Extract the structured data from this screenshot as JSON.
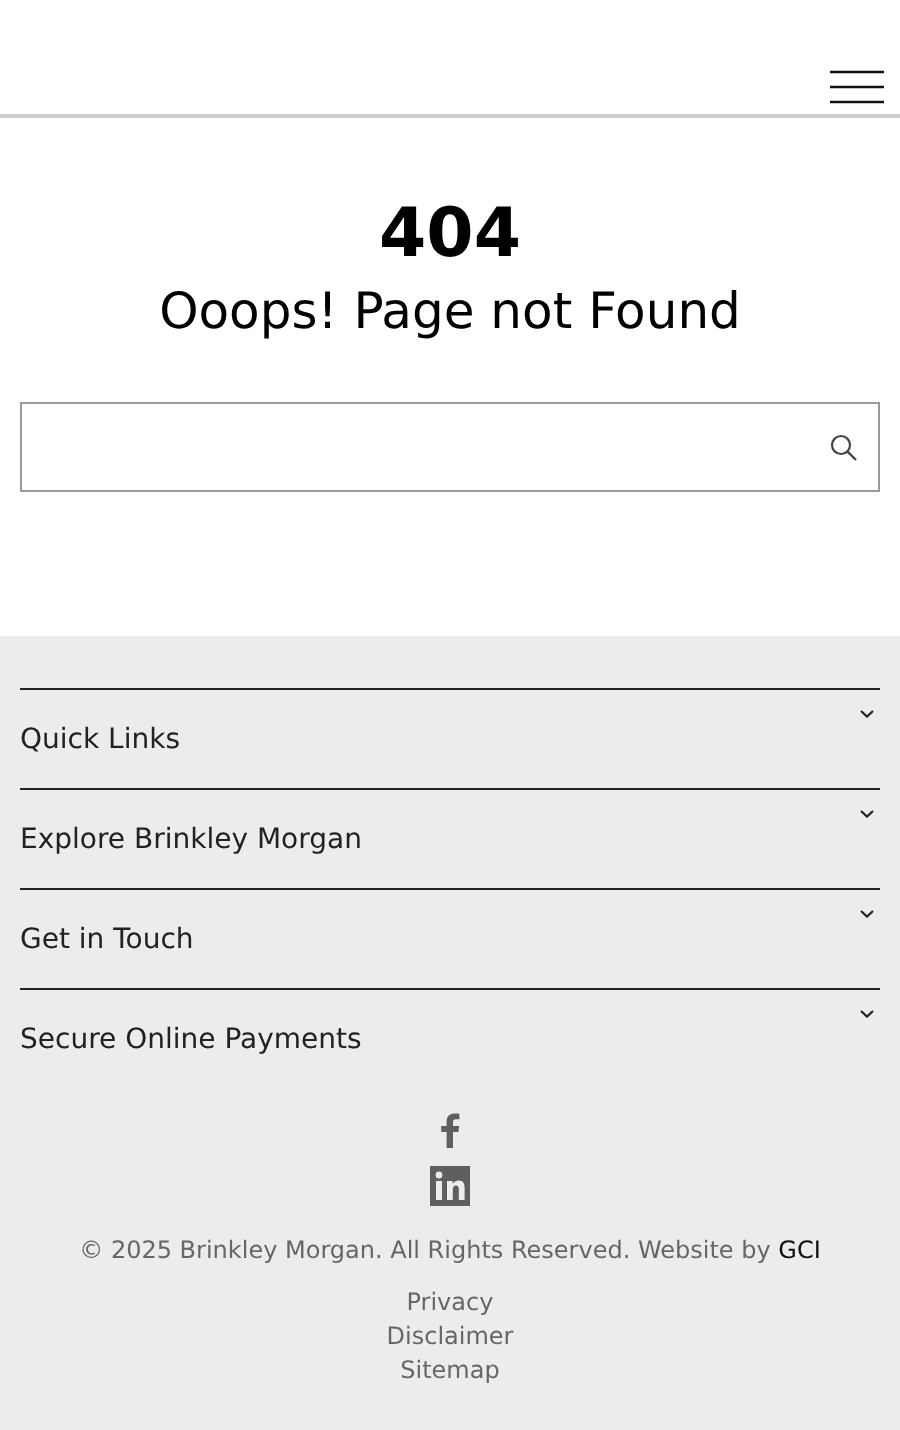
{
  "error": {
    "code": "404",
    "message": "Ooops! Page not Found"
  },
  "footer": {
    "sections": [
      {
        "label": "Quick Links",
        "expanded": false
      },
      {
        "label": "Explore Brinkley Morgan",
        "expanded": false
      },
      {
        "label": "Get in Touch",
        "expanded": false
      },
      {
        "label": "Secure Online Payments",
        "expanded": false
      }
    ],
    "copyright": "© 2025 Brinkley Morgan. All Rights Reserved. Website by ",
    "credit_link": "GCI",
    "links": [
      "Privacy",
      "Disclaimer",
      "Sitemap"
    ]
  }
}
